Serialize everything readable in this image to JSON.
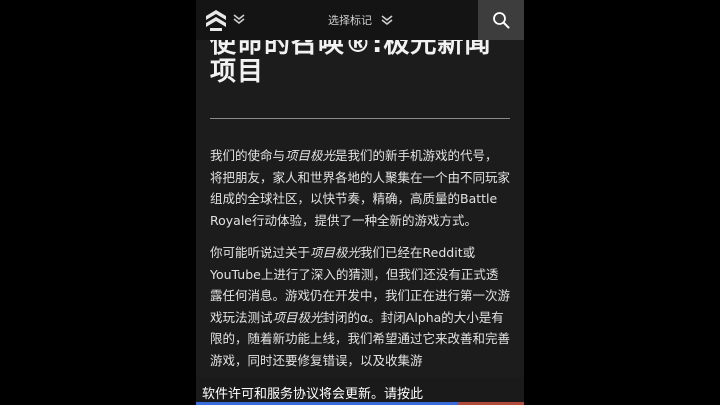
{
  "header": {
    "tag_select_label": "选择标记",
    "logo_icon": "chevron-stack-logo",
    "search_icon": "search-icon"
  },
  "article": {
    "title_line1": "使命的召唤®:极光新闻",
    "title_line2": "项目",
    "p1_a": "我们的使命与",
    "p1_em": "项目极光",
    "p1_b": "是我们的新手机游戏的代号，将把朋友，家人和世界各地的人聚集在一个由不同玩家组成的全球社区，以快节奏，精确，高质量的Battle Royale行动体验，提供了一种全新的游戏方式。",
    "p2_a": "你可能听说过关于",
    "p2_em1": "项目极光",
    "p2_b": "我们已经在Reddit或YouTube上进行了深入的猜测，但我们还没有正式透露任何消息。游戏仍在开发中，我们正在进行第一次游戏玩法测试",
    "p2_em2": "项目极光",
    "p2_c": "封闭的α。封闭Alpha的大小是有限的，随着新功能上线，我们希望通过它来改善和完善游戏，同时还要修复错误，以及收集游"
  },
  "banner": {
    "text": "软件许可和服务协议将会更新。请按此"
  },
  "colors": {
    "background": "#000000",
    "panel": "#1c1c1c",
    "topbar": "#141414",
    "search_button": "#3d3d3d"
  }
}
